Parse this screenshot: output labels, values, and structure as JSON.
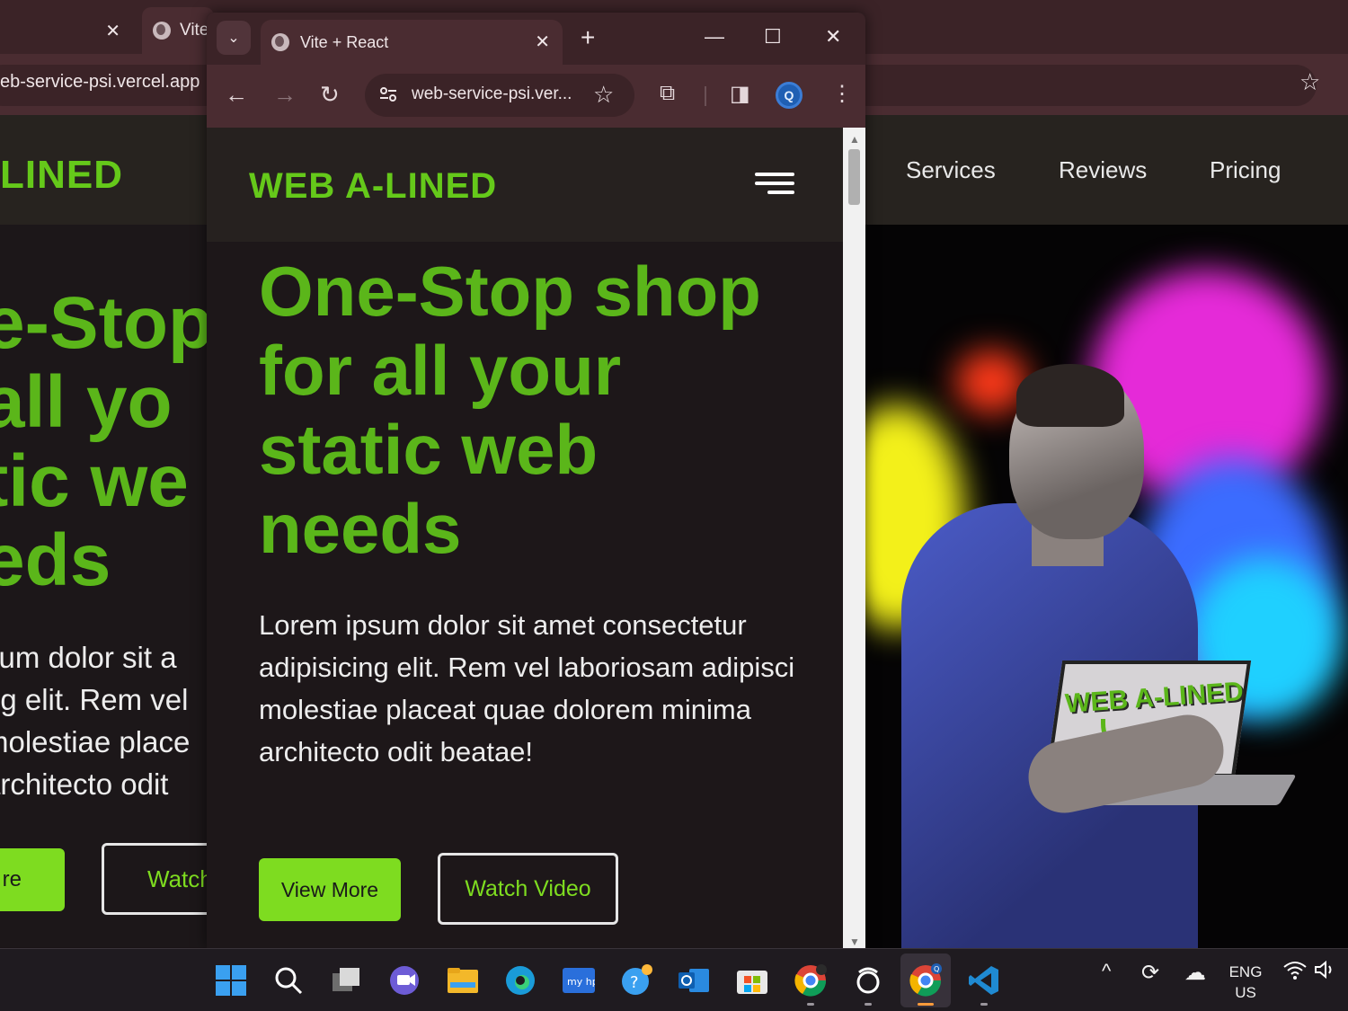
{
  "background_window": {
    "tabs": [
      {
        "label": ""
      },
      {
        "label": "Vite"
      }
    ],
    "url": "eb-service-psi.vercel.app",
    "site": {
      "logo_partial": "LINED",
      "nav_links": [
        "Services",
        "Reviews",
        "Pricing"
      ],
      "hero_lines": [
        "e-Stop",
        " all yo",
        "tic we",
        "eds"
      ],
      "paragraph_lines": [
        "sum dolor sit a",
        "ng elit. Rem vel",
        "molestiae place",
        "architecto odit"
      ],
      "primary_button_partial": "re",
      "secondary_button_partial": "Watch"
    },
    "hero_image": {
      "laptop_text": "WEB A-LINED"
    }
  },
  "foreground_window": {
    "tab_title": "Vite + React",
    "omnibox_url": "web-service-psi.ver...",
    "profile_initial": "Q",
    "site": {
      "logo": "WEB A-LINED",
      "hero_heading": "One-Stop shop for all your static web needs",
      "paragraph": "Lorem ipsum dolor sit amet consectetur adipisicing elit. Rem vel laboriosam adipisci molestiae placeat quae dolorem minima architecto odit beatae!",
      "primary_button": "View More",
      "secondary_button": "Watch Video"
    }
  },
  "taskbar": {
    "icons": [
      "windows-start",
      "search",
      "task-view",
      "teams-chat",
      "file-explorer",
      "edge",
      "hp-app",
      "get-help",
      "outlook",
      "microsoft-store",
      "chrome",
      "app-ring",
      "chrome-profile-q",
      "vscode"
    ],
    "language_line1": "ENG",
    "language_line2": "US"
  },
  "colors": {
    "accent_green": "#5bb61a",
    "button_green": "#7edc20",
    "browser_frame": "#3b2327",
    "browser_toolbar": "#4a2c31",
    "page_bg": "#1d1719",
    "nav_bg": "#26211f"
  }
}
